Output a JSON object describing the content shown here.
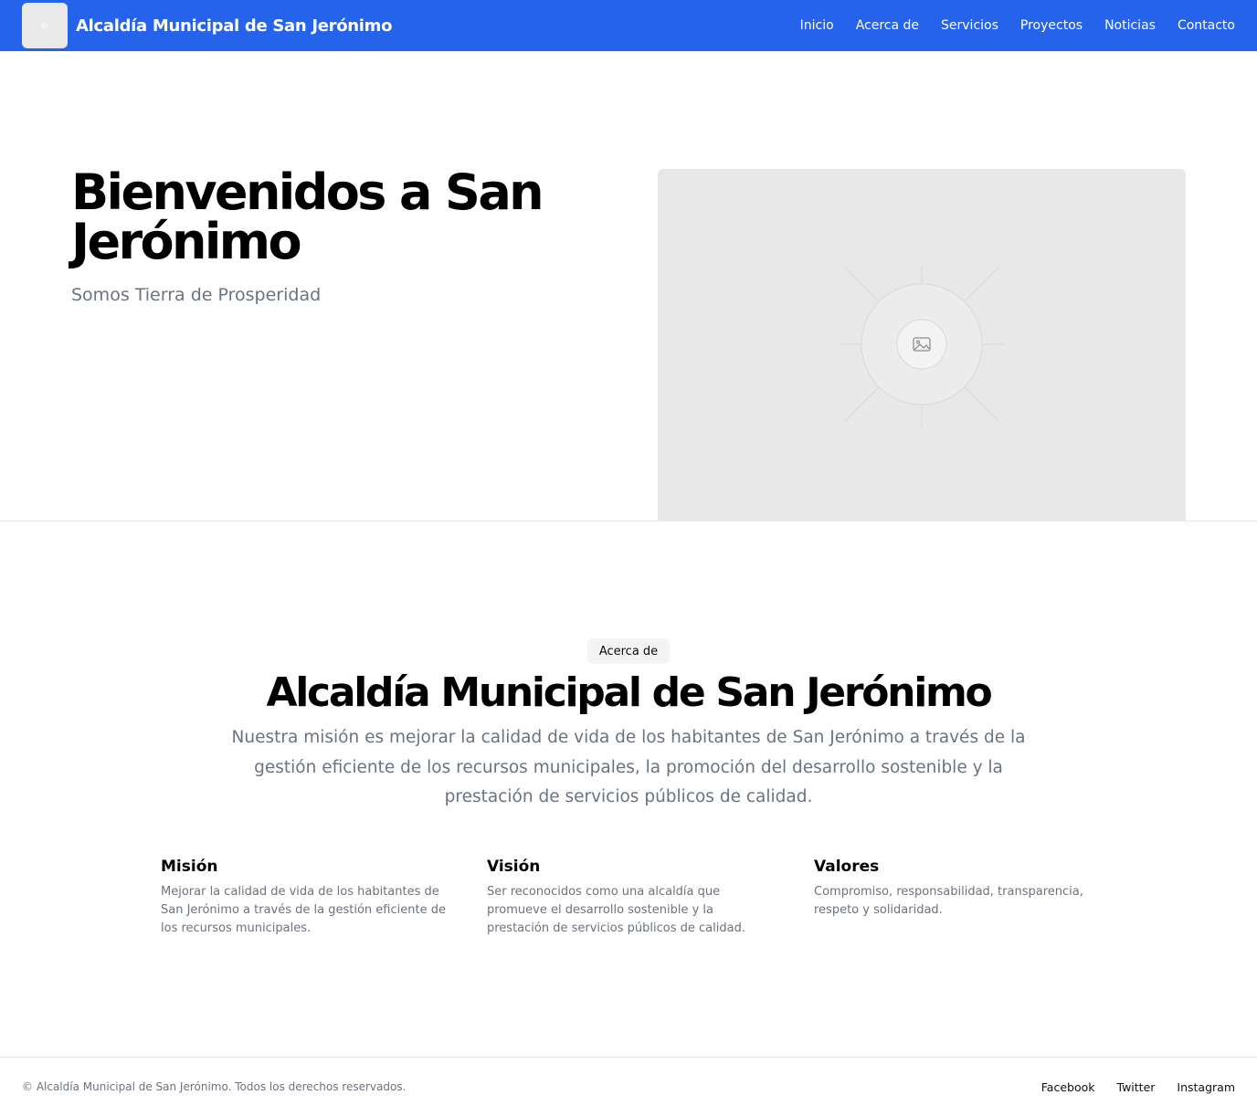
{
  "header": {
    "brand": "Alcaldía Municipal de San Jerónimo",
    "nav": [
      "Inicio",
      "Acerca de",
      "Servicios",
      "Proyectos",
      "Noticias",
      "Contacto"
    ]
  },
  "hero": {
    "title": "Bienvenidos a San Jerónimo",
    "subtitle": "Somos Tierra de Prosperidad",
    "image_icon": "image-placeholder-icon"
  },
  "about": {
    "badge": "Acerca de",
    "title": "Alcaldía Municipal de San Jerónimo",
    "description": "Nuestra misión es mejorar la calidad de vida de los habitantes de San Jerónimo a través de la gestión eficiente de los recursos municipales, la promoción del desarrollo sostenible y la prestación de servicios públicos de calidad.",
    "features": [
      {
        "title": "Misión",
        "text": "Mejorar la calidad de vida de los habitantes de San Jerónimo a través de la gestión eficiente de los recursos municipales."
      },
      {
        "title": "Visión",
        "text": "Ser reconocidos como una alcaldía que promueve el desarrollo sostenible y la prestación de servicios públicos de calidad."
      },
      {
        "title": "Valores",
        "text": "Compromiso, responsabilidad, transparencia, respeto y solidaridad."
      }
    ]
  },
  "footer": {
    "copyright": "© Alcaldía Municipal de San Jerónimo. Todos los derechos reservados.",
    "social": [
      "Facebook",
      "Twitter",
      "Instagram"
    ]
  },
  "colors": {
    "header_bg": "#2563eb",
    "muted_text": "#6b7280",
    "placeholder_bg": "#e8e8e8"
  }
}
